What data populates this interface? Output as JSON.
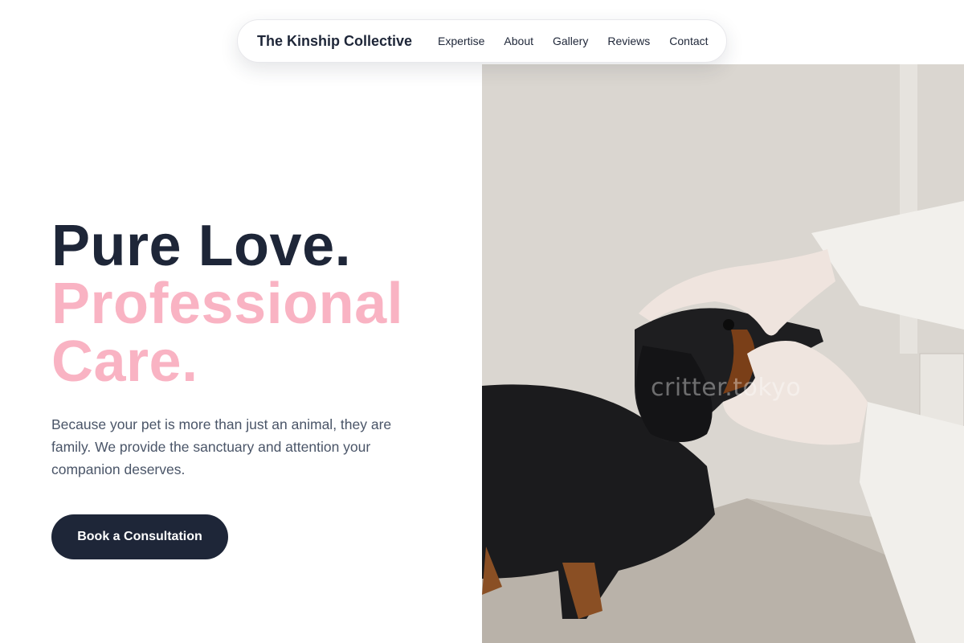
{
  "nav": {
    "brand": "The Kinship Collective",
    "links": [
      "Expertise",
      "About",
      "Gallery",
      "Reviews",
      "Contact"
    ]
  },
  "hero": {
    "heading_line1": "Pure Love.",
    "heading_line2": "Professional",
    "heading_line3": "Care.",
    "lead": "Because your pet is more than just an animal, they are family. We provide the sanctuary and attention your companion deserves.",
    "cta_label": "Book a Consultation"
  },
  "photo": {
    "watermark": "critter.tokyo",
    "subject": "veterinarian examining a dachshund's mouth"
  },
  "colors": {
    "navy": "#1e2638",
    "pink": "#f9b3c3",
    "body_text": "#4a5568"
  }
}
